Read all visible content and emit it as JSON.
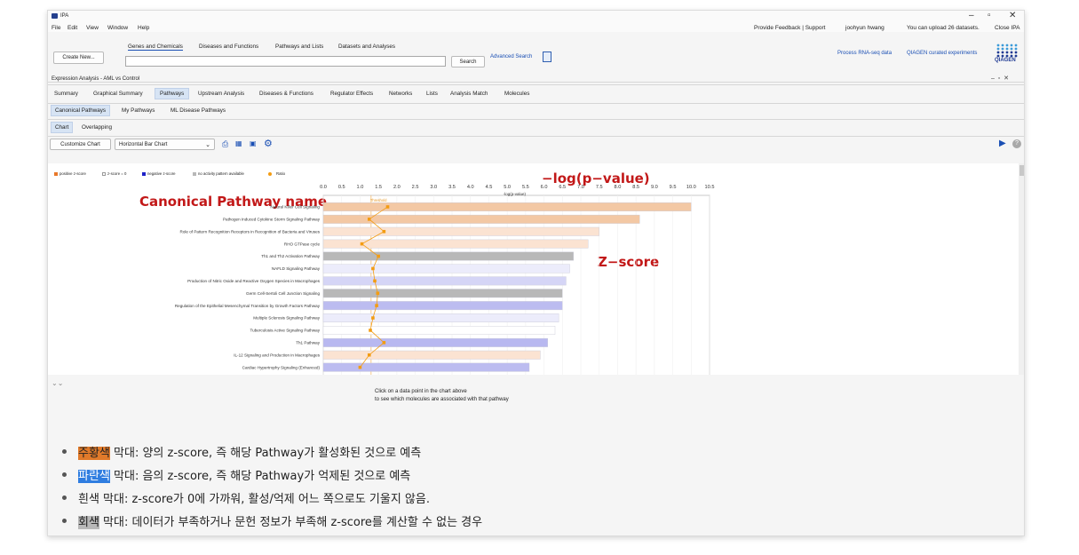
{
  "window": {
    "app_name": "IPA",
    "minimize": "–",
    "restore": "▫",
    "close": "✕"
  },
  "menu": {
    "items": [
      "File",
      "Edit",
      "View",
      "Window",
      "Help"
    ],
    "feedback": "Provide Feedback | Support",
    "user": "joohyun hwang",
    "upload": "You can upload 26 datasets.",
    "close_ipa": "Close IPA"
  },
  "toolbar": {
    "search_tabs": [
      "Genes and Chemicals",
      "Diseases and Functions",
      "Pathways and Lists",
      "Datasets and Analyses"
    ],
    "create_new": "Create New...",
    "search_button": "Search",
    "advanced_search": "Advanced Search",
    "process_rnaseq": "Process RNA-seq data",
    "qiagen_curated": "QIAGEN curated experiments",
    "logo_text": "QIAGEN",
    "search_value": ""
  },
  "analysis": {
    "title": "Expression Analysis - AML vs Control",
    "tabs": [
      "Summary",
      "Graphical Summary",
      "Pathways",
      "Upstream Analysis",
      "Diseases & Functions",
      "Regulator Effects",
      "Networks",
      "Lists",
      "Analysis Match",
      "Molecules"
    ],
    "selected_tab": "Pathways",
    "pathway_tabs": [
      "Canonical Pathways",
      "My Pathways",
      "ML Disease Pathways"
    ],
    "view_tabs": [
      "Chart",
      "Overlapping"
    ],
    "customize_chart": "Customize Chart",
    "chart_type": "Horizontal Bar Chart"
  },
  "legend": {
    "items": [
      {
        "label": "positive z-score",
        "color": "#e9782a"
      },
      {
        "label": "z-score = 0",
        "color": "#ffffff"
      },
      {
        "label": "negative z-score",
        "color": "#1e22c8"
      },
      {
        "label": "no activity pattern available",
        "color": "#b8b8b8"
      },
      {
        "label": "Ratio",
        "color": "#f39c12"
      }
    ]
  },
  "annotations": {
    "pvalue": "−log(p−value)",
    "pathway_name": "Canonical Pathway name",
    "zscore": "Z−score"
  },
  "chart_data": {
    "type": "bar",
    "orientation": "horizontal",
    "xlabel": "-log(p-value)",
    "threshold_label": "Threshold",
    "threshold": 1.3,
    "xlim": [
      0,
      10.5
    ],
    "xticks": [
      "0.0",
      "0.5",
      "1.0",
      "1.5",
      "2.0",
      "2.5",
      "3.0",
      "3.5",
      "4.0",
      "4.5",
      "5.0",
      "5.5",
      "6.0",
      "6.5",
      "7.0",
      "7.5",
      "8.0",
      "8.5",
      "9.0",
      "9.5",
      "10.0",
      "10.5"
    ],
    "categories": [
      "Natural Killer Cell Signaling",
      "Pathogen Induced Cytokine Storm Signaling Pathway",
      "Role of Pattern Recognition Receptors in Recognition of Bacteria and Viruses",
      "RHO GTPase cycle",
      "Th1 and Th2 Activation Pathway",
      "NAFLD Signaling Pathway",
      "Production of Nitric Oxide and Reactive Oxygen Species in Macrophages",
      "Germ Cell-Sertoli Cell Junction Signaling",
      "Regulation of the Epithelial Mesenchymal Transition by Growth Factors Pathway",
      "Multiple Sclerosis Signaling Pathway",
      "Tuberculosis Active Signaling Pathway",
      "Th1 Pathway",
      "IL-12 Signaling and Production in Macrophages",
      "Cardiac Hypertrophy Signaling (Enhanced)"
    ],
    "values": [
      10.0,
      8.6,
      7.5,
      7.2,
      6.8,
      6.7,
      6.6,
      6.5,
      6.5,
      6.4,
      6.3,
      6.1,
      5.9,
      5.6
    ],
    "colors": [
      "#f3c8a4",
      "#f3c8a4",
      "#fbe3d2",
      "#fbe3d2",
      "#b8b8b8",
      "#ececfb",
      "#d5d5f6",
      "#b8b8b8",
      "#bcbcf0",
      "#ececfb",
      "#ffffff",
      "#b8b8f0",
      "#fbe3d2",
      "#bcbcf0"
    ],
    "ratio": [
      0.175,
      0.125,
      0.165,
      0.105,
      0.15,
      0.135,
      0.14,
      0.148,
      0.145,
      0.135,
      0.128,
      0.165,
      0.125,
      0.1
    ]
  },
  "bottom": {
    "hint_line1": "Click on a data point in the chart above",
    "hint_line2": "to see which molecules are associated with that pathway",
    "bullets": [
      {
        "highlight": "주황색",
        "text": " 막대: 양의 z-score, 즉 해당 Pathway가 활성화된 것으로 예측"
      },
      {
        "highlight": "파란색",
        "text": " 막대: 음의 z-score, 즉 해당 Pathway가 억제된 것으로 예측"
      },
      {
        "highlight": "",
        "text": "흰색 막대: z-score가 0에 가까워, 활성/억제 어느 쪽으로도 기울지 않음."
      },
      {
        "highlight": "회색",
        "text": " 막대: 데이터가 부족하거나 문헌 정보가 부족해 z-score를 계산할 수 없는 경우"
      }
    ]
  }
}
